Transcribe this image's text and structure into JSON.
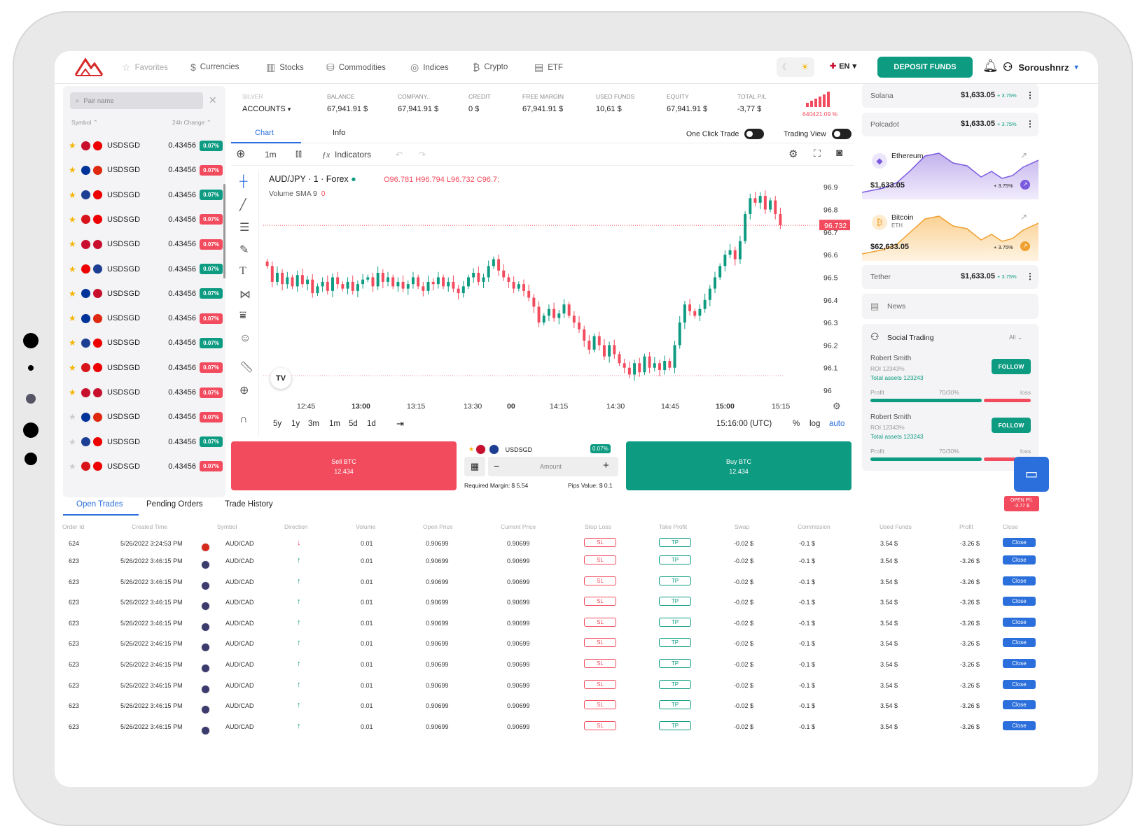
{
  "nav": {
    "items": [
      {
        "label": "Favorites",
        "icon": "star-icon",
        "glyph": "☆"
      },
      {
        "label": "Currencies",
        "icon": "coin-icon",
        "glyph": "$"
      },
      {
        "label": "Stocks",
        "icon": "bar-chart-icon",
        "glyph": "▥"
      },
      {
        "label": "Commodities",
        "icon": "commodities-icon",
        "glyph": "⛁"
      },
      {
        "label": "Indices",
        "icon": "indices-icon",
        "glyph": "◎"
      },
      {
        "label": "Crypto",
        "icon": "bitcoin-icon",
        "glyph": "₿"
      },
      {
        "label": "ETF",
        "icon": "document-icon",
        "glyph": "▤"
      }
    ],
    "lang": "EN",
    "deposit": "DEPOSIT FUNDS",
    "username": "Soroushnrz"
  },
  "pairs": {
    "search_placeholder": "Pair name",
    "col_symbol": "Symbol",
    "col_change": "24h Change",
    "rows": [
      {
        "name": "USDSGD",
        "value": "0.43456",
        "change": "0.07%",
        "dir": "up",
        "fav": true,
        "f1": "#c8102e",
        "f2": "#e00"
      },
      {
        "name": "USDSGD",
        "value": "0.43456",
        "change": "0.07%",
        "dir": "down",
        "fav": true,
        "f1": "#003399",
        "f2": "#de2910"
      },
      {
        "name": "USDSGD",
        "value": "0.43456",
        "change": "0.07%",
        "dir": "up",
        "fav": true,
        "f1": "#1c3f94",
        "f2": "#e00"
      },
      {
        "name": "USDSGD",
        "value": "0.43456",
        "change": "0.07%",
        "dir": "down",
        "fav": true,
        "f1": "#d7141a",
        "f2": "#e00"
      },
      {
        "name": "USDSGD",
        "value": "0.43456",
        "change": "0.07%",
        "dir": "down",
        "fav": true,
        "f1": "#c8102e",
        "f2": "#c8102e"
      },
      {
        "name": "USDSGD",
        "value": "0.43456",
        "change": "0.07%",
        "dir": "up",
        "fav": true,
        "f1": "#e00",
        "f2": "#1c3f94"
      },
      {
        "name": "USDSGD",
        "value": "0.43456",
        "change": "0.07%",
        "dir": "up",
        "fav": true,
        "f1": "#003399",
        "f2": "#c8102e"
      },
      {
        "name": "USDSGD",
        "value": "0.43456",
        "change": "0.07%",
        "dir": "down",
        "fav": true,
        "f1": "#003399",
        "f2": "#de2910"
      },
      {
        "name": "USDSGD",
        "value": "0.43456",
        "change": "0.07%",
        "dir": "up",
        "fav": true,
        "f1": "#1c3f94",
        "f2": "#e00"
      },
      {
        "name": "USDSGD",
        "value": "0.43456",
        "change": "0.07%",
        "dir": "down",
        "fav": true,
        "f1": "#d7141a",
        "f2": "#e00"
      },
      {
        "name": "USDSGD",
        "value": "0.43456",
        "change": "0.07%",
        "dir": "down",
        "fav": true,
        "f1": "#c8102e",
        "f2": "#c8102e"
      },
      {
        "name": "USDSGD",
        "value": "0.43456",
        "change": "0.07%",
        "dir": "down",
        "fav": false,
        "f1": "#003399",
        "f2": "#de2910"
      },
      {
        "name": "USDSGD",
        "value": "0.43456",
        "change": "0.07%",
        "dir": "up",
        "fav": false,
        "f1": "#1c3f94",
        "f2": "#e00"
      },
      {
        "name": "USDSGD",
        "value": "0.43456",
        "change": "0.07%",
        "dir": "down",
        "fav": false,
        "f1": "#d7141a",
        "f2": "#e00"
      }
    ]
  },
  "account": {
    "fields": [
      {
        "label": "SILVER",
        "value": "ACCOUNTS"
      },
      {
        "label": "BALANCE",
        "value": "67,941.91 $"
      },
      {
        "label": "COMPANY..",
        "value": "67,941.91 $"
      },
      {
        "label": "CREDIT",
        "value": "0 $"
      },
      {
        "label": "FREE MARGIN",
        "value": "67,941.91 $"
      },
      {
        "label": "USED FUNDS",
        "value": "10,61 $"
      },
      {
        "label": "EQUITY",
        "value": "67,941.91 $"
      },
      {
        "label": "TOTAL P/L",
        "value": "-3,77 $"
      }
    ],
    "margin_level": "640421.09 %"
  },
  "chart_tabs": {
    "chart": "Chart",
    "info": "Info",
    "one_click": "One Click Trade",
    "trading_view": "Trading View"
  },
  "toolbar": {
    "interval": "1m",
    "indicators": "Indicators"
  },
  "chart_header": {
    "symbol": "AUD/JPY · 1 · Forex",
    "o": "O96.781",
    "h": "H96.794",
    "l": "L96.732",
    "c": "C96.7:",
    "volume": "Volume SMA 9",
    "volume_val": "0",
    "price_tag": "96.732"
  },
  "chart_bottom": {
    "ranges": [
      "5y",
      "1y",
      "3m",
      "1m",
      "5d",
      "1d"
    ],
    "time": "15:16:00 (UTC)",
    "pct": "%",
    "log": "log",
    "auto": "auto"
  },
  "chart_data": {
    "type": "line",
    "title": "AUD/JPY · 1 · Forex",
    "yticks": [
      96.9,
      96.8,
      96.7,
      96.6,
      96.5,
      96.4,
      96.3,
      96.2,
      96.1,
      96.0
    ],
    "ylim": [
      95.96,
      96.95
    ],
    "xticks": [
      "12:45",
      "13:00",
      "13:15",
      "13:30",
      "00",
      "14:15",
      "14:30",
      "14:45",
      "15:00",
      "15:15"
    ],
    "close": [
      96.55,
      96.48,
      96.52,
      96.47,
      96.5,
      96.46,
      96.51,
      96.47,
      96.49,
      96.43,
      96.46,
      96.48,
      96.44,
      96.5,
      96.47,
      96.45,
      96.48,
      96.44,
      96.47,
      96.49,
      96.5,
      96.46,
      96.52,
      96.48,
      96.5,
      96.46,
      96.48,
      96.45,
      96.47,
      96.5,
      96.46,
      96.44,
      96.48,
      96.47,
      96.5,
      96.46,
      96.48,
      96.45,
      96.43,
      96.46,
      96.5,
      96.52,
      96.48,
      96.5,
      96.55,
      96.58,
      96.53,
      96.5,
      96.48,
      96.45,
      96.47,
      96.44,
      96.41,
      96.37,
      96.3,
      96.33,
      96.36,
      96.32,
      96.34,
      96.38,
      96.33,
      96.3,
      96.27,
      96.22,
      96.18,
      96.24,
      96.2,
      96.15,
      96.2,
      96.16,
      96.12,
      96.1,
      96.07,
      96.12,
      96.08,
      96.15,
      96.1,
      96.12,
      96.09,
      96.13,
      96.1,
      96.2,
      96.3,
      96.38,
      96.35,
      96.33,
      96.36,
      96.4,
      96.45,
      96.5,
      96.55,
      96.6,
      96.62,
      96.58,
      96.66,
      96.78,
      96.85,
      96.83,
      96.86,
      96.8,
      96.84,
      96.78,
      96.73
    ]
  },
  "trade": {
    "sell_label": "Sell BTC",
    "sell_price": "12.434",
    "buy_label": "Buy BTC",
    "buy_price": "12.434",
    "pair": "USDSGD",
    "pair_change": "0.07%",
    "amount_placeholder": "Amount",
    "margin": "Required Margin: $ 5.54",
    "pips": "Pips Value: $ 0.1"
  },
  "right": {
    "solana": {
      "name": "Solana",
      "price": "$1,633.05",
      "pct": "+ 3.75%"
    },
    "polcadot": {
      "name": "Polcadot",
      "price": "$1,633.05",
      "pct": "+ 3.75%"
    },
    "ethereum": {
      "name": "Ethereum",
      "price": "$1,633.05",
      "pct": "+ 3.75%"
    },
    "bitcoin": {
      "name": "Bitcoin",
      "sub": "ETH",
      "price": "$62,633.05",
      "pct": "+ 3.75%"
    },
    "tether": {
      "name": "Tether",
      "price": "$1,633.05",
      "pct": "+ 3.75%"
    },
    "news": "News",
    "social": {
      "title": "Social Trading",
      "filter": "All",
      "traders": [
        {
          "name": "Robert Smith",
          "roi": "ROI 12343%",
          "assets": "Total assets 123243",
          "profit": "Profit",
          "ratio": "70/30%",
          "loss": "loss",
          "follow": "FOLLOW"
        },
        {
          "name": "Robert Smith",
          "roi": "ROI 12343%",
          "assets": "Total assets 123243",
          "profit": "Profit",
          "ratio": "70/30%",
          "loss": "loss",
          "follow": "FOLLOW"
        }
      ]
    }
  },
  "bottom": {
    "tabs": [
      "Open Trades",
      "Pending Orders",
      "Trade History"
    ],
    "open_pl_label": "OPEN P/L",
    "open_pl": "-3.77 $",
    "headers": [
      "Order Id",
      "Created Time",
      "Symbol",
      "Direction",
      "Volume",
      "Open Price",
      "Current Price",
      "Stop Loss",
      "Take Profit",
      "Swap",
      "Commission",
      "Used Funds",
      "Profit",
      "Close"
    ],
    "rows": [
      {
        "id": "624",
        "time": "5/26/2022 3:24:53 PM",
        "symbol": "AUD/CAD",
        "dir": "down",
        "volume": "0.01",
        "open": "0.90699",
        "current": "0.90699",
        "sl": "SL",
        "tp": "TP",
        "swap": "-0.02 $",
        "comm": "-0.1 $",
        "funds": "3.54 $",
        "profit": "-3.26 $",
        "close": "Close"
      },
      {
        "id": "623",
        "time": "5/26/2022 3:46:15 PM",
        "symbol": "AUD/CAD",
        "dir": "up",
        "volume": "0.01",
        "open": "0.90699",
        "current": "0.90699",
        "sl": "SL",
        "tp": "TP",
        "swap": "-0.02 $",
        "comm": "-0.1 $",
        "funds": "3.54 $",
        "profit": "-3.26 $",
        "close": "Close"
      },
      {
        "id": "623",
        "time": "5/26/2022 3:46:15 PM",
        "symbol": "AUD/CAD",
        "dir": "up",
        "volume": "0.01",
        "open": "0.90699",
        "current": "0.90699",
        "sl": "SL",
        "tp": "TP",
        "swap": "-0.02 $",
        "comm": "-0.1 $",
        "funds": "3.54 $",
        "profit": "-3.26 $",
        "close": "Close"
      },
      {
        "id": "623",
        "time": "5/26/2022 3:46:15 PM",
        "symbol": "AUD/CAD",
        "dir": "up",
        "volume": "0.01",
        "open": "0.90699",
        "current": "0.90699",
        "sl": "SL",
        "tp": "TP",
        "swap": "-0.02 $",
        "comm": "-0.1 $",
        "funds": "3.54 $",
        "profit": "-3.26 $",
        "close": "Close"
      },
      {
        "id": "623",
        "time": "5/26/2022 3:46:15 PM",
        "symbol": "AUD/CAD",
        "dir": "up",
        "volume": "0.01",
        "open": "0.90699",
        "current": "0.90699",
        "sl": "SL",
        "tp": "TP",
        "swap": "-0.02 $",
        "comm": "-0.1 $",
        "funds": "3.54 $",
        "profit": "-3.26 $",
        "close": "Close"
      },
      {
        "id": "623",
        "time": "5/26/2022 3:46:15 PM",
        "symbol": "AUD/CAD",
        "dir": "up",
        "volume": "0.01",
        "open": "0.90699",
        "current": "0.90699",
        "sl": "SL",
        "tp": "TP",
        "swap": "-0.02 $",
        "comm": "-0.1 $",
        "funds": "3.54 $",
        "profit": "-3.26 $",
        "close": "Close"
      },
      {
        "id": "623",
        "time": "5/26/2022 3:46:15 PM",
        "symbol": "AUD/CAD",
        "dir": "up",
        "volume": "0.01",
        "open": "0.90699",
        "current": "0.90699",
        "sl": "SL",
        "tp": "TP",
        "swap": "-0.02 $",
        "comm": "-0.1 $",
        "funds": "3.54 $",
        "profit": "-3.26 $",
        "close": "Close"
      },
      {
        "id": "623",
        "time": "5/26/2022 3:46:15 PM",
        "symbol": "AUD/CAD",
        "dir": "up",
        "volume": "0.01",
        "open": "0.90699",
        "current": "0.90699",
        "sl": "SL",
        "tp": "TP",
        "swap": "-0.02 $",
        "comm": "-0.1 $",
        "funds": "3.54 $",
        "profit": "-3.26 $",
        "close": "Close"
      },
      {
        "id": "623",
        "time": "5/26/2022 3:46:15 PM",
        "symbol": "AUD/CAD",
        "dir": "up",
        "volume": "0.01",
        "open": "0.90699",
        "current": "0.90699",
        "sl": "SL",
        "tp": "TP",
        "swap": "-0.02 $",
        "comm": "-0.1 $",
        "funds": "3.54 $",
        "profit": "-3.26 $",
        "close": "Close"
      },
      {
        "id": "623",
        "time": "5/26/2022 3:46:15 PM",
        "symbol": "AUD/CAD",
        "dir": "up",
        "volume": "0.01",
        "open": "0.90699",
        "current": "0.90699",
        "sl": "SL",
        "tp": "TP",
        "swap": "-0.02 $",
        "comm": "-0.1 $",
        "funds": "3.54 $",
        "profit": "-3.26 $",
        "close": "Close"
      }
    ]
  },
  "colors": {
    "green": "#0d9b82",
    "red": "#f34b5e",
    "blue": "#2a6fdb"
  }
}
